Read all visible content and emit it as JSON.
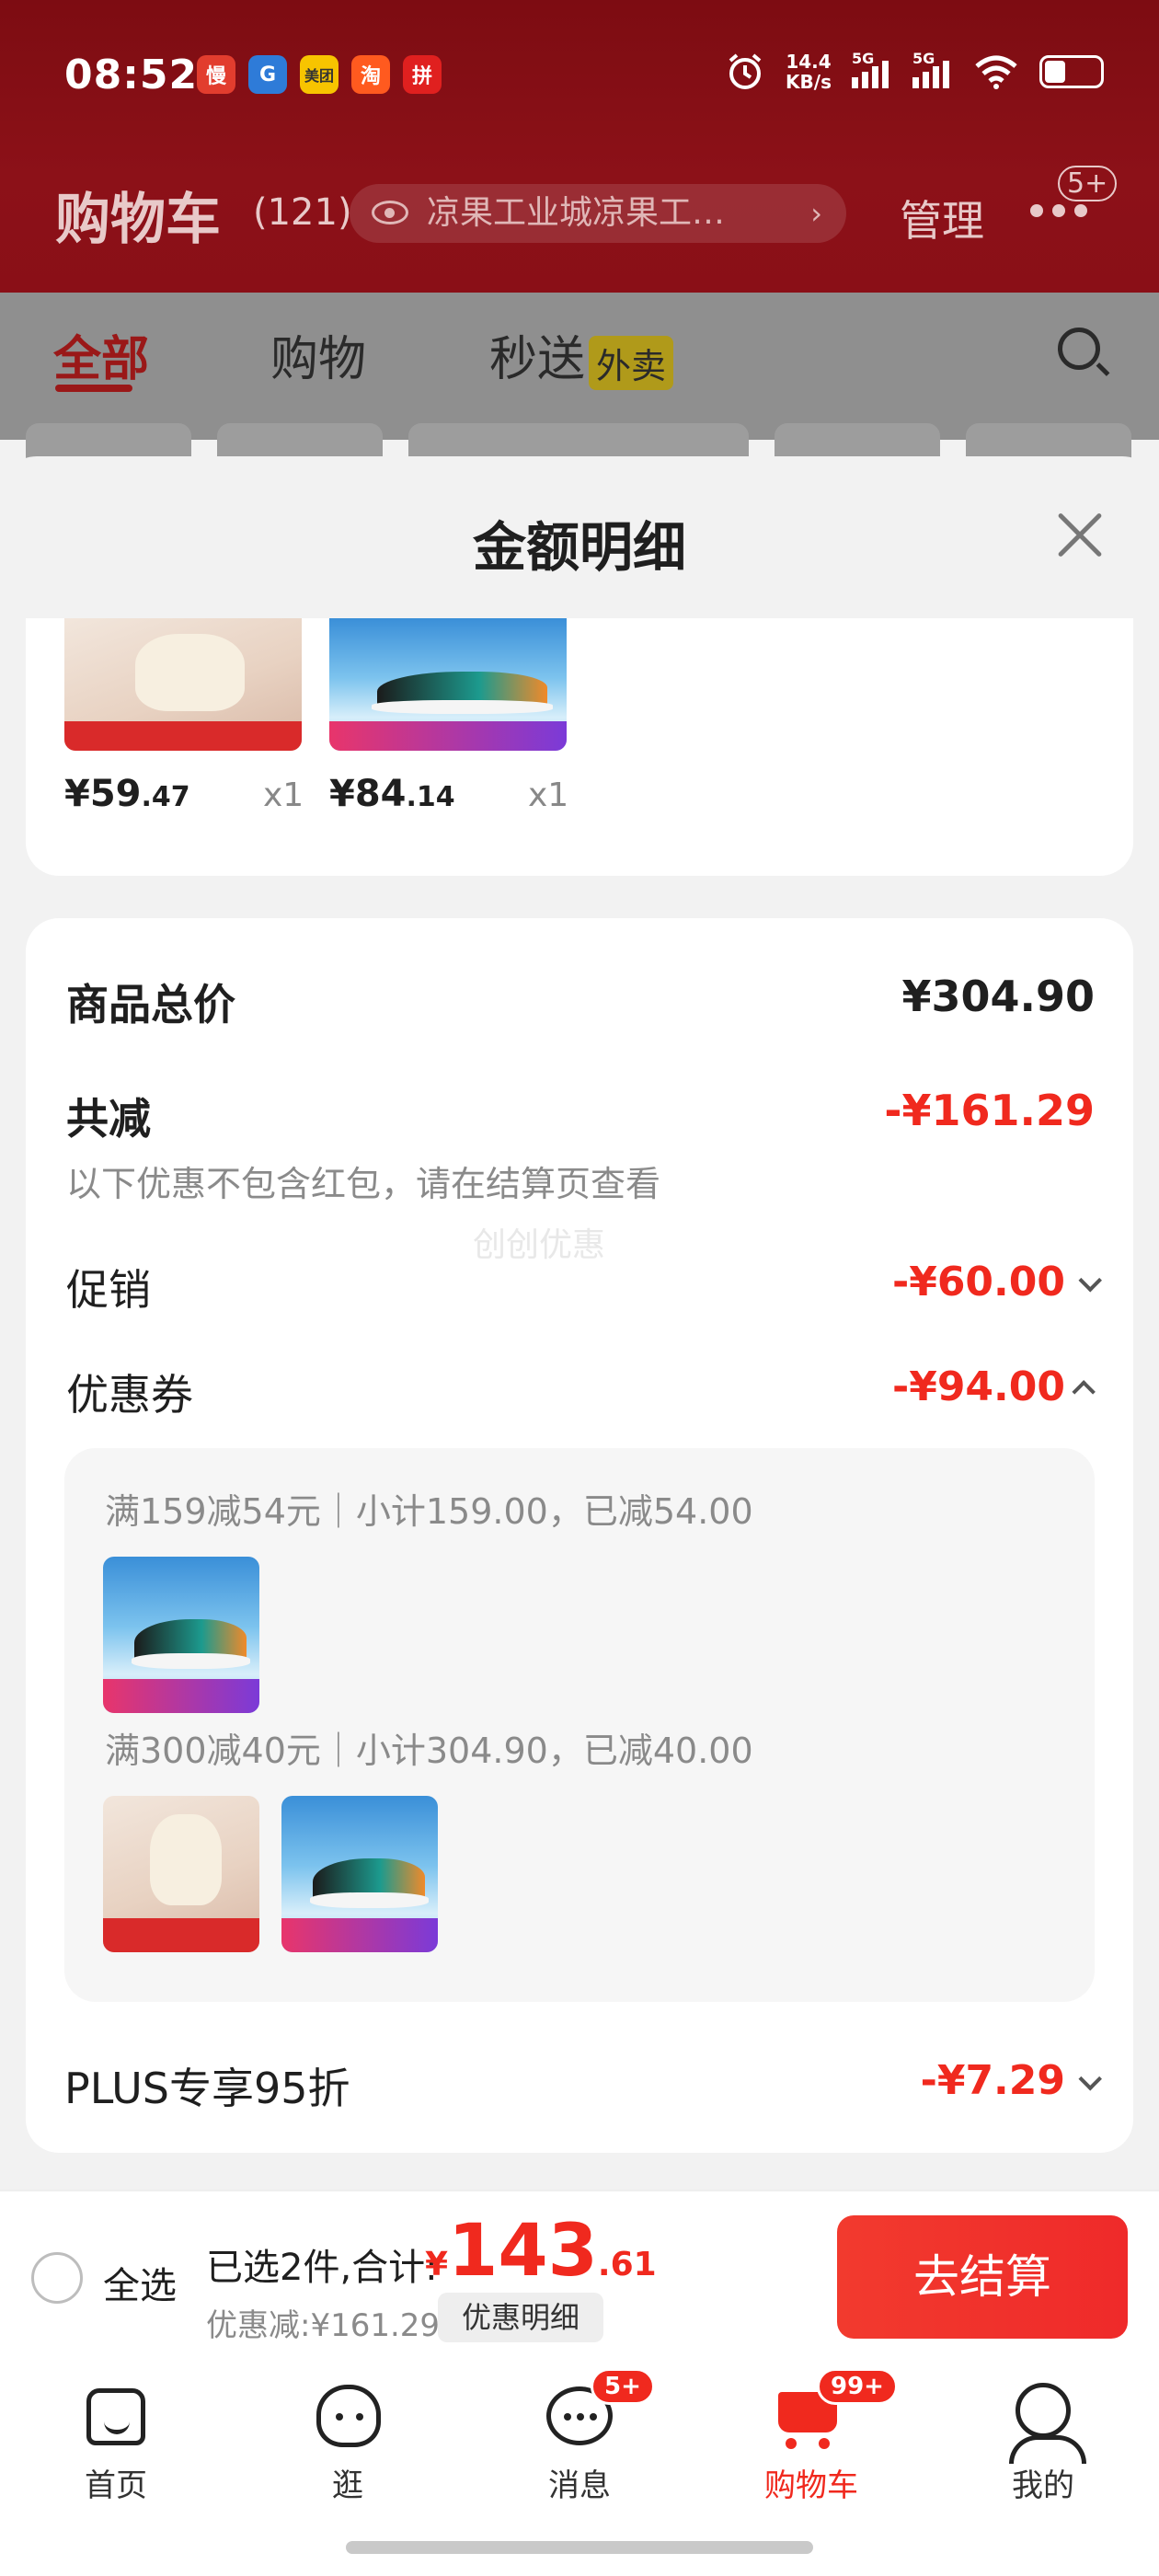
{
  "status_bar": {
    "time": "08:52",
    "app_icons": [
      {
        "name": "app-icon-1",
        "glyph": "慢",
        "color": "#e23d2e"
      },
      {
        "name": "app-icon-2",
        "glyph": "G",
        "color": "#2e7bd8"
      },
      {
        "name": "app-icon-3",
        "glyph": "美团",
        "color": "#f7c400"
      },
      {
        "name": "app-icon-4",
        "glyph": "淘",
        "color": "#ff5a1f"
      },
      {
        "name": "app-icon-5",
        "glyph": "拼",
        "color": "#e0201f"
      }
    ],
    "net_speed_value": "14.4",
    "net_speed_unit": "KB/s",
    "signal_1": "5G",
    "signal_2": "5G"
  },
  "background": {
    "cart_title": "购物车",
    "cart_count": "(121)",
    "address": "凉果工业城凉果工…",
    "manage": "管理",
    "more_badge": "5+",
    "tabs": [
      {
        "label": "全部"
      },
      {
        "label": "购物"
      },
      {
        "label": "秒送"
      }
    ],
    "tab_badge": "外卖"
  },
  "sheet": {
    "title": "金额明细",
    "items": [
      {
        "price_int": "¥59",
        "price_dec": ".47",
        "qty": "x1"
      },
      {
        "price_int": "¥84",
        "price_dec": ".14",
        "qty": "x1"
      }
    ],
    "goods_total_label": "商品总价",
    "goods_total_value": "¥304.90",
    "total_discount_label": "共减",
    "total_discount_value": "-¥161.29",
    "note": "以下优惠不包含红包，请在结算页查看",
    "watermark": "创创优惠",
    "promo_label": "促销",
    "promo_value": "-¥60.00",
    "coupon_label": "优惠券",
    "coupon_value": "-¥94.00",
    "coupon_rules": [
      "满159减54元｜小计159.00，已减54.00",
      "满300减40元｜小计304.90，已减40.00"
    ],
    "plus_label": "PLUS专享95折",
    "plus_value": "-¥7.29"
  },
  "checkout": {
    "select_all": "全选",
    "selected_text": "已选2件,合计:",
    "currency": "¥",
    "total_int": "143",
    "total_dec": ".61",
    "discount_text": "优惠减:¥161.29",
    "detail_button": "优惠明细",
    "checkout_button": "去结算"
  },
  "tabbar": {
    "items": [
      {
        "label": "首页"
      },
      {
        "label": "逛"
      },
      {
        "label": "消息",
        "badge": "5+"
      },
      {
        "label": "购物车",
        "badge": "99+"
      },
      {
        "label": "我的"
      }
    ]
  },
  "colors": {
    "accent_red": "#f0291e",
    "header_red": "#8c1118"
  }
}
